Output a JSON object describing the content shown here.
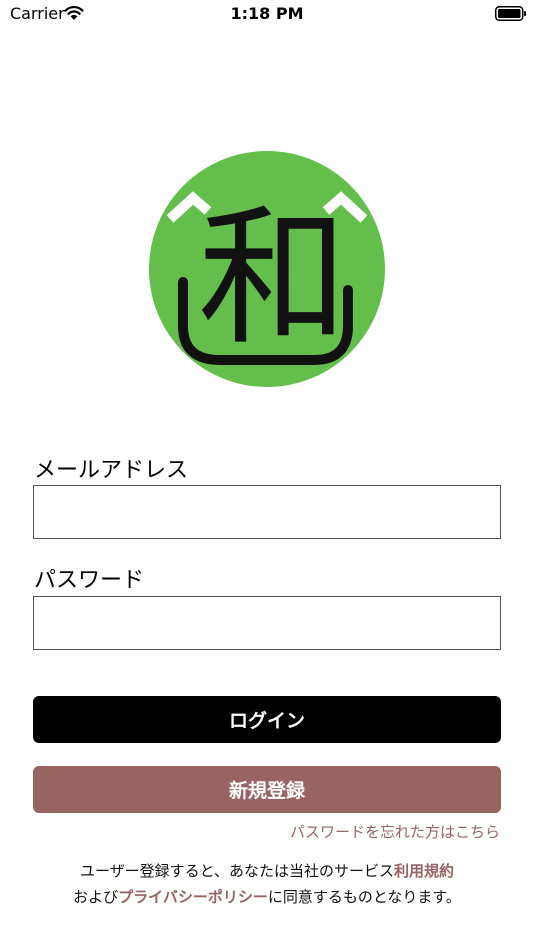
{
  "status_bar": {
    "carrier": "Carrier",
    "time": "1:18 PM"
  },
  "logo": {
    "glyph": "和",
    "circle_color": "#64be4b"
  },
  "form": {
    "email_label": "メールアドレス",
    "email_value": "",
    "password_label": "パスワード",
    "password_value": ""
  },
  "buttons": {
    "login_label": "ログイン",
    "register_label": "新規登録"
  },
  "forgot_password_link": "パスワードを忘れた方はこちら",
  "terms": {
    "line1_prefix": "ユーザー登録すると、あなたは当社のサービス",
    "terms_link": "利用規約",
    "line2_prefix": "および",
    "privacy_link": "プライバシーポリシー",
    "line2_suffix": "に同意するものとなります。"
  },
  "colors": {
    "accent": "#976462",
    "login_button": "#000000",
    "logo_green": "#64be4b"
  }
}
